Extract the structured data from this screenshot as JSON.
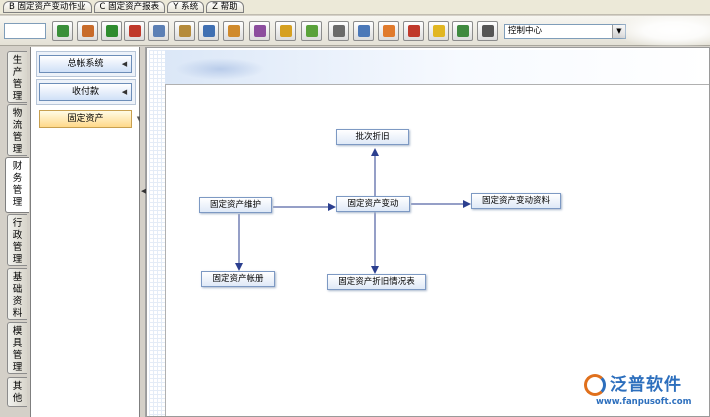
{
  "menubar": {
    "items": [
      {
        "key": "B",
        "label": "B 固定资产变动作业"
      },
      {
        "key": "C",
        "label": "C 固定资产报表"
      },
      {
        "key": "Y",
        "label": "Y 系统"
      },
      {
        "key": "Z",
        "label": "Z 帮助"
      }
    ]
  },
  "toolbar": {
    "input_value": "",
    "buttons": [
      {
        "icon": "refresh-icon",
        "color": "#3a8f3a"
      },
      {
        "icon": "home-icon",
        "color": "#c86b2a"
      },
      {
        "icon": "check-icon",
        "color": "#2f8c2f"
      },
      {
        "icon": "paint-icon",
        "color": "#c0392b"
      },
      {
        "icon": "picture-icon",
        "color": "#5b7fb5"
      },
      {
        "icon": "book-icon",
        "color": "#b58b3c"
      },
      {
        "icon": "window-icon",
        "color": "#3f6fb2"
      },
      {
        "icon": "gear-icon",
        "color": "#d08a2c"
      },
      {
        "icon": "bag-icon",
        "color": "#8c4d9e"
      },
      {
        "icon": "exchange-icon",
        "color": "#d6a020"
      },
      {
        "icon": "download-icon",
        "color": "#5aa23b"
      },
      {
        "icon": "calculator-icon",
        "color": "#6a6a6a"
      },
      {
        "icon": "document-icon",
        "color": "#4b78b8"
      },
      {
        "icon": "chart-icon",
        "color": "#e07a2c"
      },
      {
        "icon": "flower-icon",
        "color": "#c0392b"
      },
      {
        "icon": "bell-icon",
        "color": "#e1b622"
      },
      {
        "icon": "exit-icon",
        "color": "#3f8a3f"
      },
      {
        "icon": "list-icon",
        "color": "#555555"
      }
    ],
    "select_value": "控制中心"
  },
  "vtabs": [
    {
      "label": "生产管理",
      "active": false
    },
    {
      "label": "物流管理",
      "active": false
    },
    {
      "label": "财务管理",
      "active": true
    },
    {
      "label": "行政管理",
      "active": false
    },
    {
      "label": "基础资料",
      "active": false
    },
    {
      "label": "模具管理",
      "active": false
    },
    {
      "label": "其他",
      "active": false
    }
  ],
  "modules": [
    {
      "label": "总帐系统",
      "active": false
    },
    {
      "label": "收付款",
      "active": false
    },
    {
      "label": "固定资产",
      "active": true
    }
  ],
  "flow": {
    "nodes": {
      "batch_depreciation": "批次折旧",
      "asset_maintenance": "固定资产维护",
      "asset_change": "固定资产变动",
      "asset_change_data": "固定资产变动资料",
      "asset_ledger": "固定资产帐册",
      "depreciation_report": "固定资产折旧情况表"
    }
  },
  "brand": {
    "name": "泛普软件",
    "url": "www.fanpusoft.com",
    "primary_color": "#2d6fbd",
    "accent_color": "#e0701c"
  }
}
